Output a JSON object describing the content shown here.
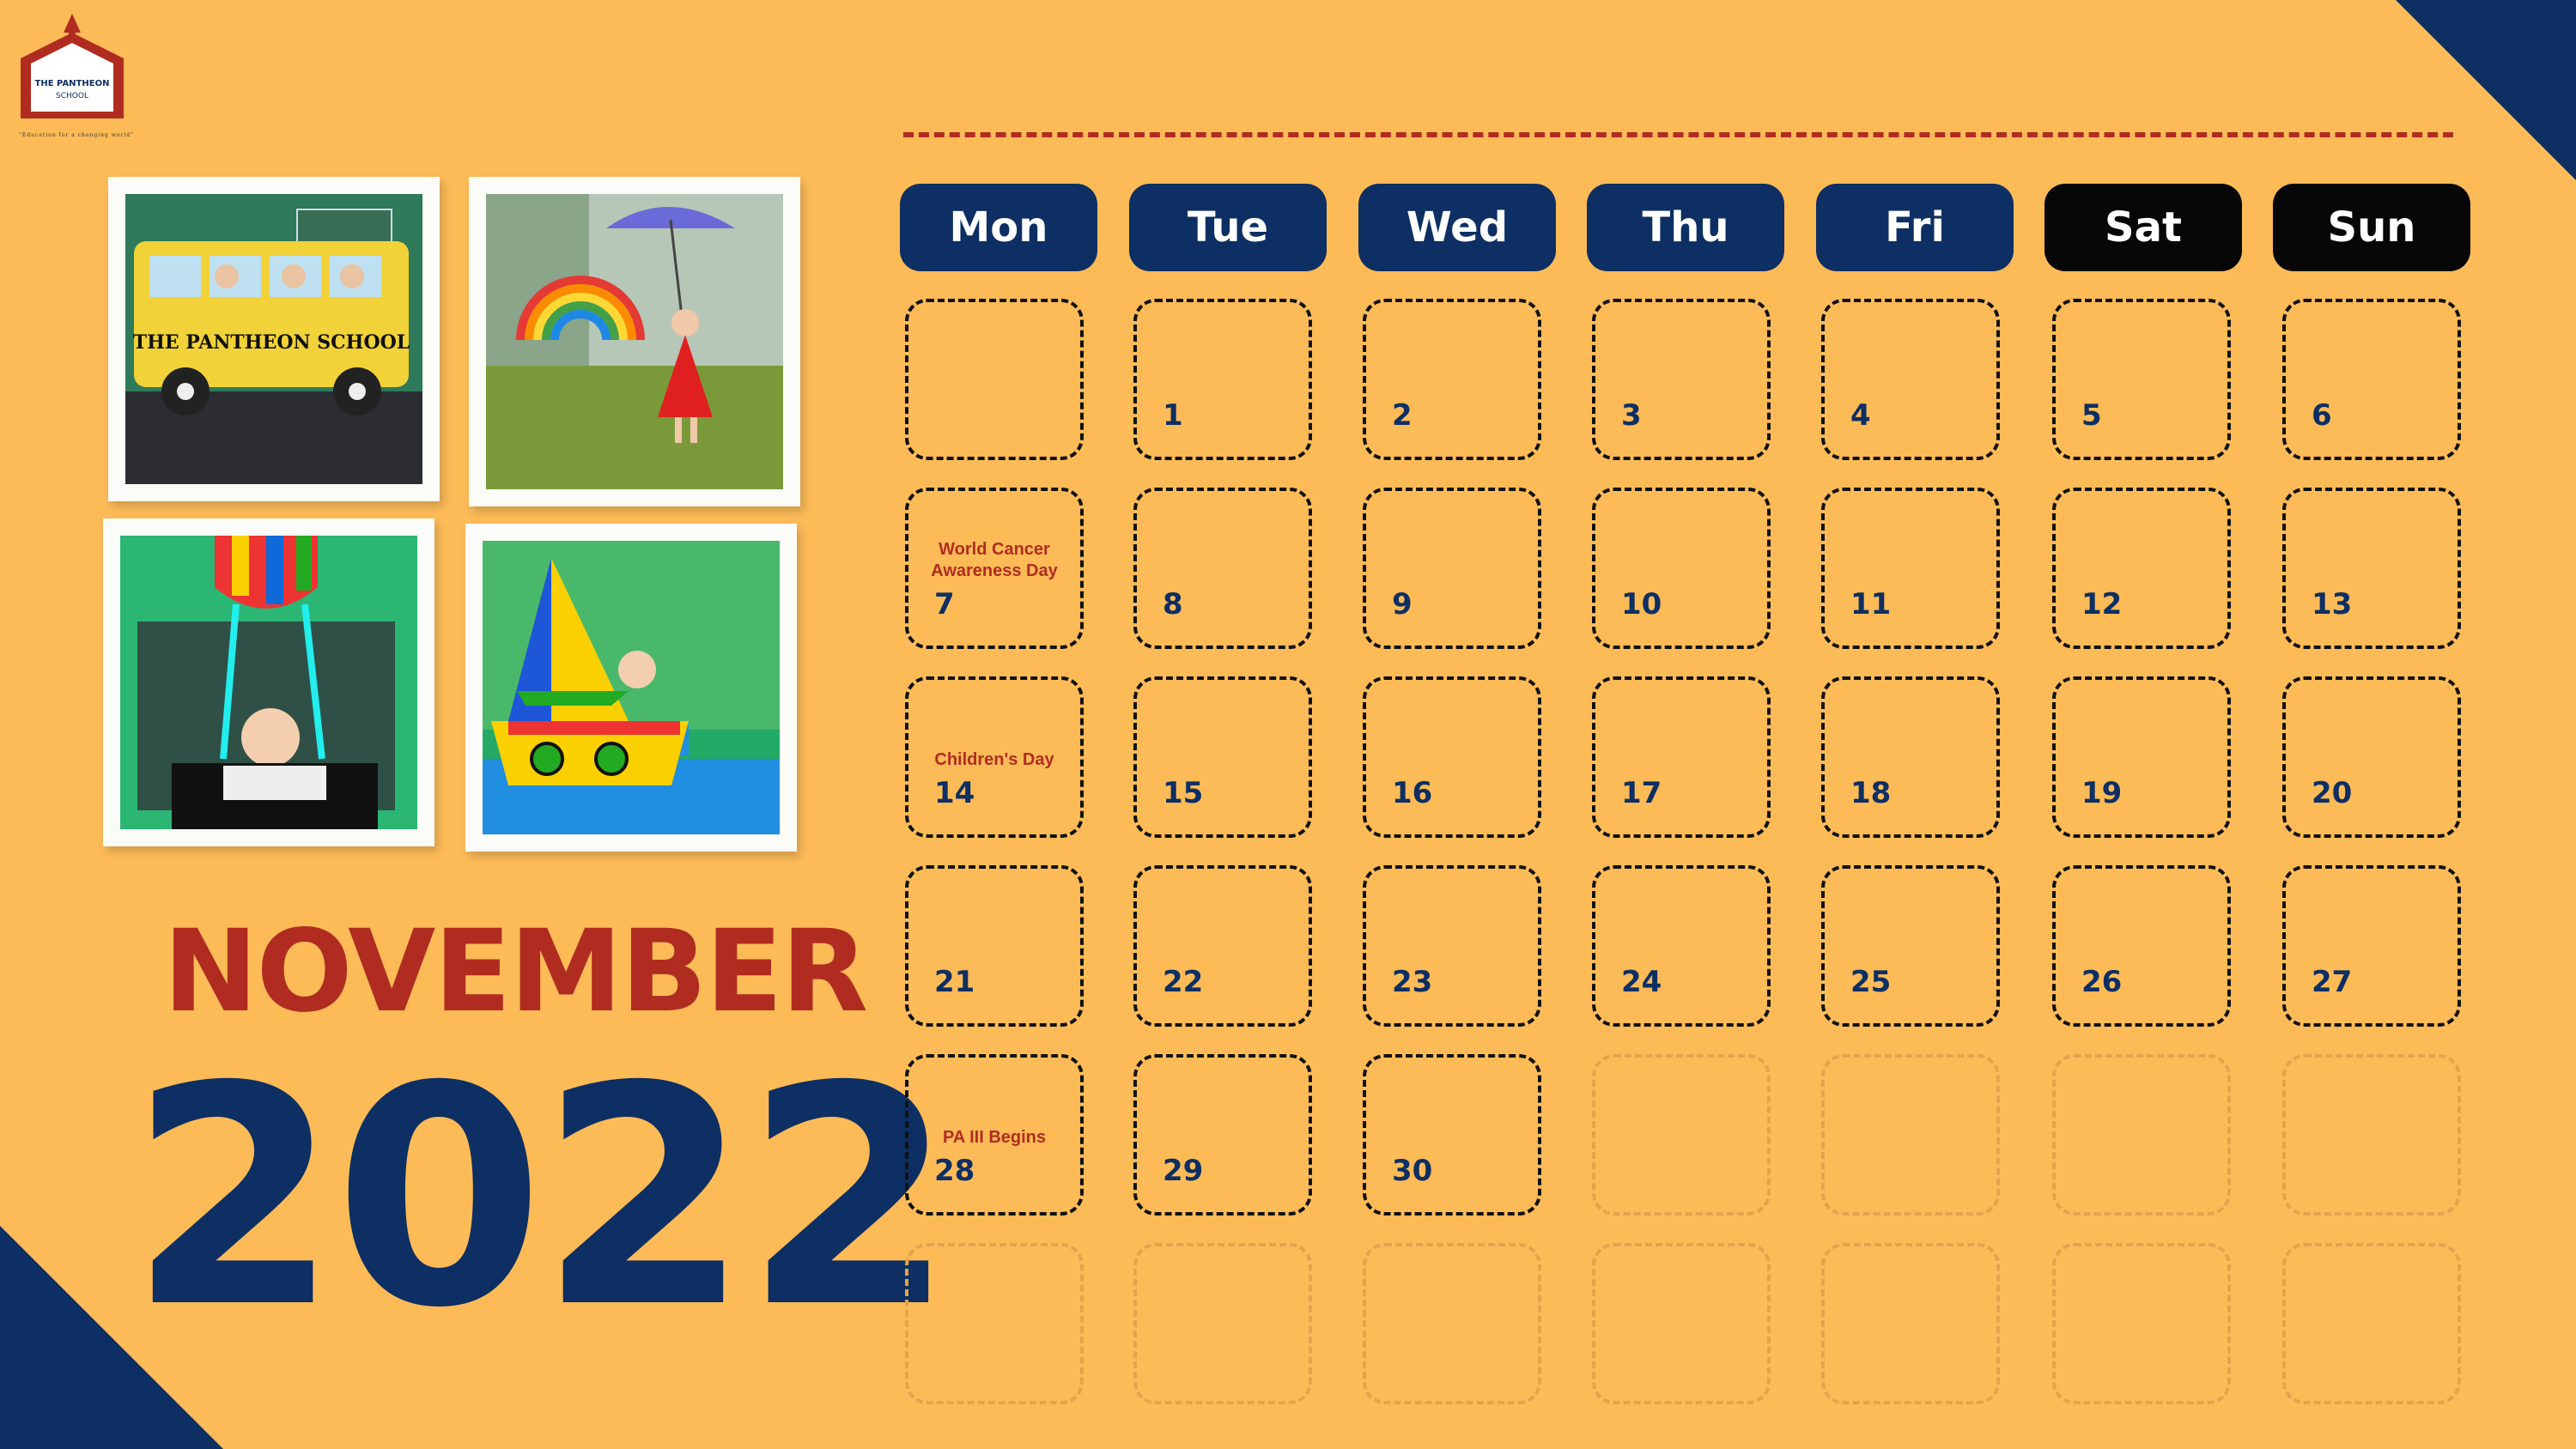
{
  "logo": {
    "name": "THE PANTHEON",
    "sub": "SCHOOL",
    "tagline": "\"Education for a changing world\""
  },
  "month": "NOVEMBER",
  "year": "2022",
  "days": [
    "Mon",
    "Tue",
    "Wed",
    "Thu",
    "Fri",
    "Sat",
    "Sun"
  ],
  "weekend_days": [
    "Sat",
    "Sun"
  ],
  "photos": [
    {
      "label": "THE PANTHEON SCHOOL",
      "scene": "school-bus"
    },
    {
      "label": "",
      "scene": "rainbow-girl"
    },
    {
      "label": "",
      "scene": "hot-air-balloon"
    },
    {
      "label": "",
      "scene": "boat"
    }
  ],
  "weeks": [
    [
      null,
      "1",
      "2",
      "3",
      "4",
      "5",
      "6"
    ],
    [
      "7",
      "8",
      "9",
      "10",
      "11",
      "12",
      "13"
    ],
    [
      "14",
      "15",
      "16",
      "17",
      "18",
      "19",
      "20"
    ],
    [
      "21",
      "22",
      "23",
      "24",
      "25",
      "26",
      "27"
    ],
    [
      "28",
      "29",
      "30",
      null,
      null,
      null,
      null
    ],
    [
      null,
      null,
      null,
      null,
      null,
      null,
      null
    ]
  ],
  "events": {
    "7": "World Cancer Awareness Day",
    "14": "Children's Day",
    "28": "PA III Begins"
  },
  "colors": {
    "background": "#fdbb58",
    "navy": "#0d2f63",
    "red": "#b02c21",
    "black": "#070707"
  }
}
